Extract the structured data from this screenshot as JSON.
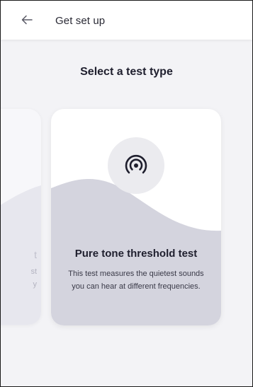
{
  "header": {
    "title": "Get set up",
    "back_icon": "arrow-left-icon"
  },
  "page": {
    "heading": "Select a test type"
  },
  "cards": [
    {
      "icon": "broadcast-signal-icon",
      "title": "Pure tone threshold test",
      "description": "This test measures the quietest sounds you can hear at different frequencies."
    }
  ],
  "peek_card": {
    "fragments": [
      "t",
      "st",
      "y"
    ]
  },
  "colors": {
    "background": "#f3f3f6",
    "card": "#ffffff",
    "wave": "#d4d4de",
    "text_primary": "#1f1f2e"
  }
}
